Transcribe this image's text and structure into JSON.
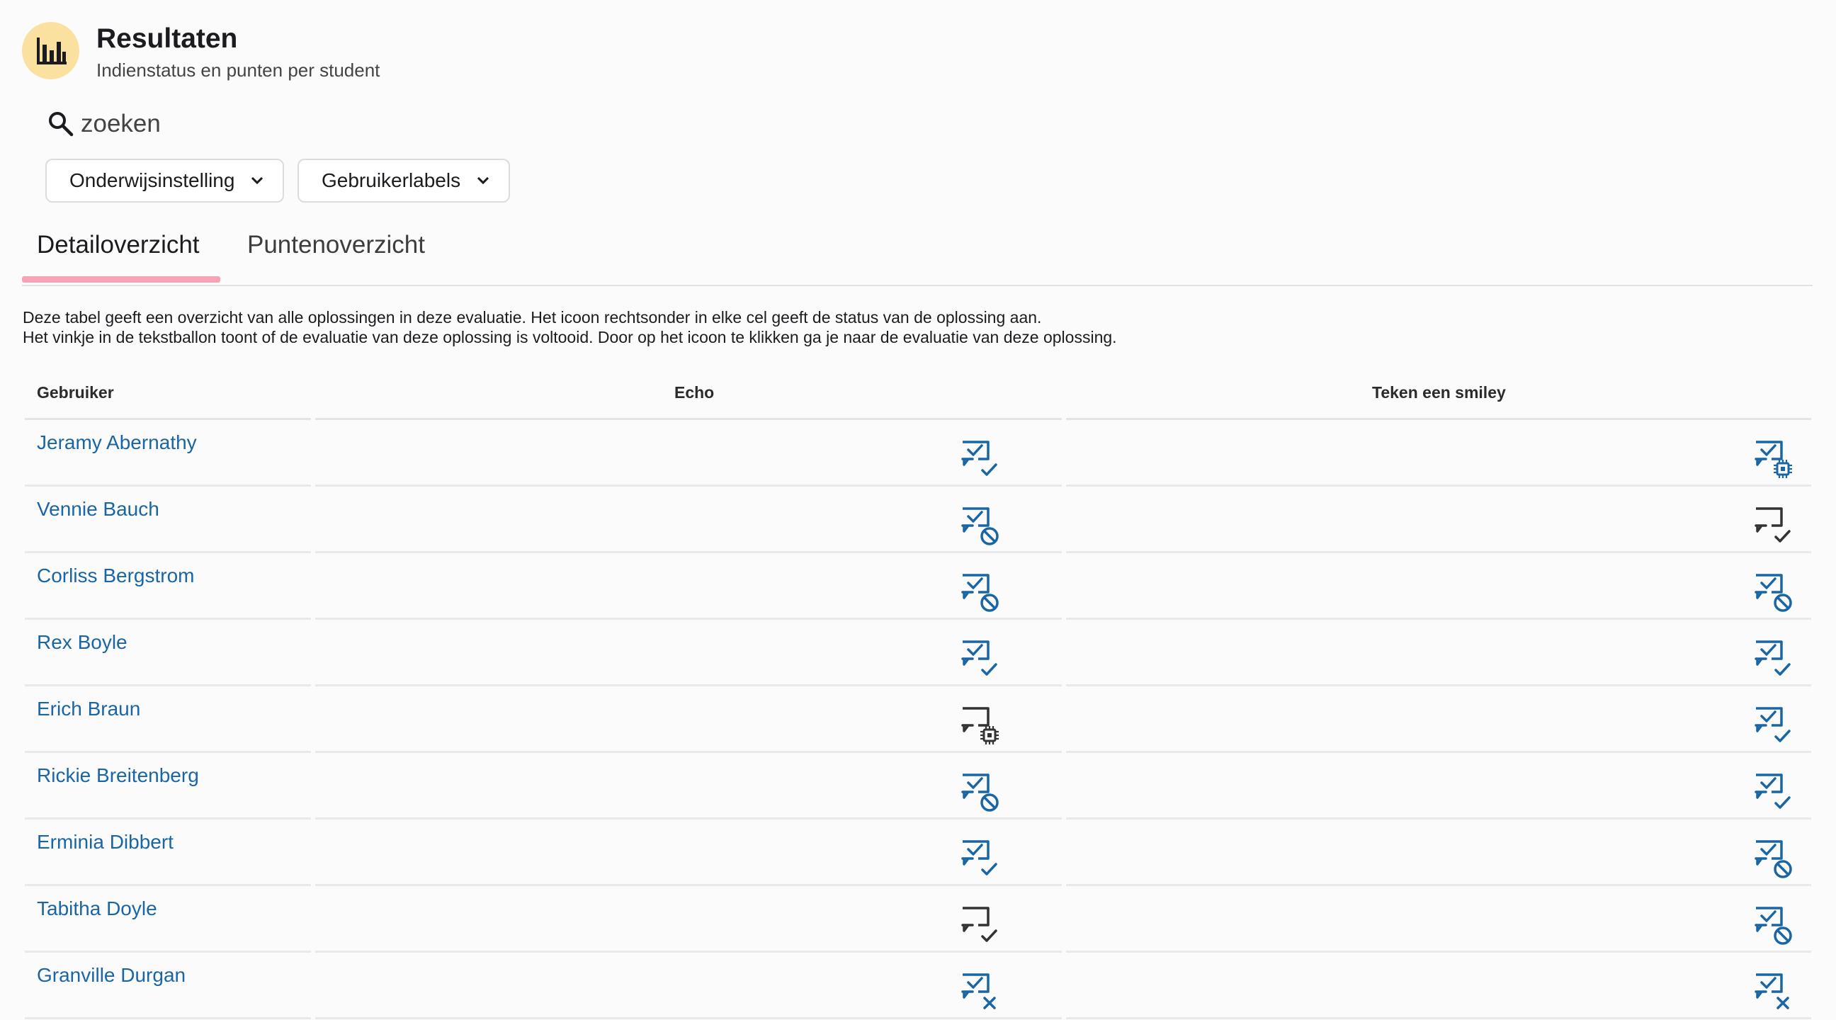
{
  "header": {
    "icon": "bar-chart-icon",
    "title": "Resultaten",
    "subtitle": "Indienstatus en punten per student",
    "accent": "#fbe1a0"
  },
  "search": {
    "placeholder": "zoeken",
    "icon": "search-icon"
  },
  "filters": [
    {
      "label": "Onderwijsinstelling",
      "icon": "chevron-down-icon"
    },
    {
      "label": "Gebruikerlabels",
      "icon": "chevron-down-icon"
    }
  ],
  "tabs": [
    {
      "label": "Detailoverzicht",
      "active": true
    },
    {
      "label": "Puntenoverzicht",
      "active": false
    }
  ],
  "info": {
    "line1": "Deze tabel geeft een overzicht van alle oplossingen in deze evaluatie. Het icoon rechtsonder in elke cel geeft de status van de oplossing aan.",
    "line2": "Het vinkje in de tekstballon toont of de evaluatie van deze oplossing is voltooid. Door op het icoon te klikken ga je naar de evaluatie van deze oplossing."
  },
  "table": {
    "columns": [
      "Gebruiker",
      "Echo",
      "Teken een smiley"
    ],
    "rows": [
      {
        "name": "Jeramy Abernathy",
        "echo": "evaluated-correct",
        "smiley": "evaluated-running"
      },
      {
        "name": "Vennie Bauch",
        "echo": "evaluated-blocked",
        "smiley": "pending-correct"
      },
      {
        "name": "Corliss Bergstrom",
        "echo": "evaluated-blocked",
        "smiley": "evaluated-blocked"
      },
      {
        "name": "Rex Boyle",
        "echo": "evaluated-correct",
        "smiley": "evaluated-correct"
      },
      {
        "name": "Erich Braun",
        "echo": "pending-running",
        "smiley": "evaluated-correct"
      },
      {
        "name": "Rickie Breitenberg",
        "echo": "evaluated-blocked",
        "smiley": "evaluated-correct"
      },
      {
        "name": "Erminia Dibbert",
        "echo": "evaluated-correct",
        "smiley": "evaluated-blocked"
      },
      {
        "name": "Tabitha Doyle",
        "echo": "pending-correct",
        "smiley": "evaluated-blocked"
      },
      {
        "name": "Granville Durgan",
        "echo": "evaluated-wrong",
        "smiley": "evaluated-wrong"
      }
    ]
  },
  "colors": {
    "link": "#1a66a5",
    "icon_done": "#1a66a5",
    "icon_pending": "#333333",
    "tab_underline": "#f6a3b6"
  }
}
